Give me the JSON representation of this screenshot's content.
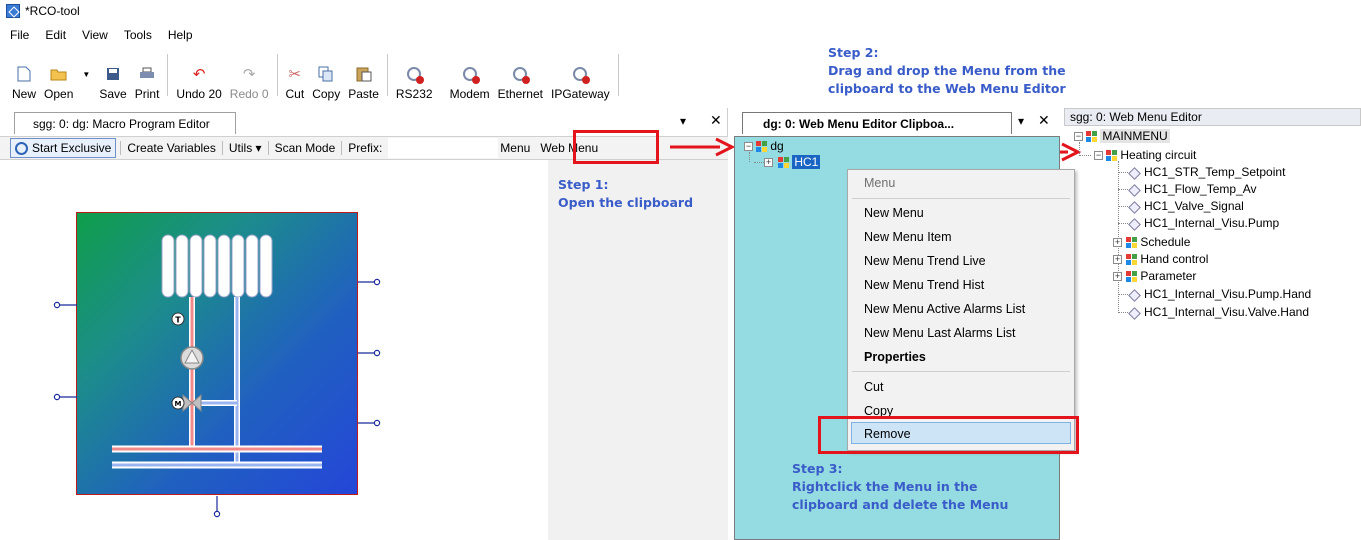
{
  "app": {
    "title": "*RCO-tool"
  },
  "menubar": [
    "File",
    "Edit",
    "View",
    "Tools",
    "Help"
  ],
  "toolbar": {
    "new": "New",
    "open": "Open",
    "save": "Save",
    "print": "Print",
    "undo": "Undo 20",
    "redo": "Redo 0",
    "cut": "Cut",
    "copy": "Copy",
    "paste": "Paste",
    "rs232": "RS232",
    "modem": "Modem",
    "ethernet": "Ethernet",
    "ipgateway": "IPGateway"
  },
  "left_panel": {
    "tab": "sgg: 0: dg: Macro Program Editor",
    "toolbar": {
      "start_exclusive": "Start Exclusive",
      "create_variables": "Create Variables",
      "utils": "Utils",
      "scan_mode": "Scan Mode",
      "prefix": "Prefix:",
      "menu": "Menu",
      "web_menu": "Web Menu"
    }
  },
  "middle_panel": {
    "tab": "dg: 0: Web Menu Editor Clipboa...",
    "tree": {
      "root": "dg",
      "child": "HC1"
    }
  },
  "context_menu": {
    "header": "Menu",
    "items": [
      "New Menu",
      "New Menu Item",
      "New Menu Trend Live",
      "New Menu Trend Hist",
      "New Menu Active Alarms List",
      "New Menu Last Alarms List"
    ],
    "properties": "Properties",
    "cut": "Cut",
    "copy": "Copy",
    "remove": "Remove"
  },
  "right_panel": {
    "header": "sgg: 0: Web Menu Editor",
    "root": "MAINMENU",
    "folder": "Heating circuit",
    "items": [
      "HC1_STR_Temp_Setpoint",
      "HC1_Flow_Temp_Av",
      "HC1_Valve_Signal",
      "HC1_Internal_Visu.Pump"
    ],
    "groups": [
      "Schedule",
      "Hand control",
      "Parameter"
    ],
    "items2": [
      "HC1_Internal_Visu.Pump.Hand",
      "HC1_Internal_Visu.Valve.Hand"
    ]
  },
  "annotations": {
    "step1": [
      "Step 1:",
      "Open the clipboard"
    ],
    "step2": [
      "Step 2:",
      "Drag and drop the Menu from the",
      "clipboard to the Web Menu Editor"
    ],
    "step3": [
      "Step 3:",
      "Rightclick the Menu in the",
      "clipboard and delete the Menu"
    ]
  },
  "colors": {
    "annotation_red": "#e3141c",
    "step_text_blue": "#3a5cc9",
    "clipboard_bg": "#94dbe2"
  }
}
